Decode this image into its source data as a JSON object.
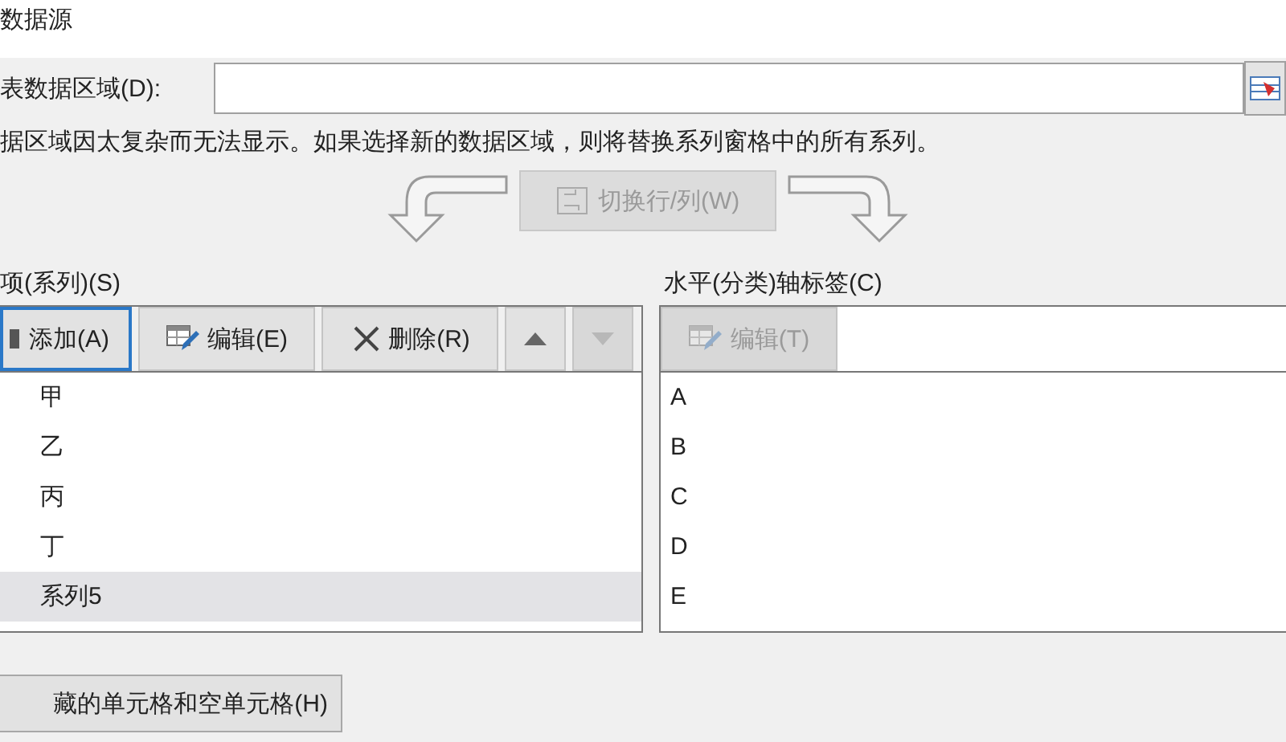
{
  "window": {
    "title": "数据源"
  },
  "range": {
    "label": "表数据区域(D):"
  },
  "message": "据区域因太复杂而无法显示。如果选择新的数据区域，则将替换系列窗格中的所有系列。",
  "switch_button": {
    "label": "切换行/列(W)",
    "disabled": true
  },
  "series_panel": {
    "label": "项(系列)(S)",
    "toolbar": [
      {
        "kind": "add",
        "label": "添加(A)",
        "focused": true,
        "disabled": false
      },
      {
        "kind": "edit",
        "label": "编辑(E)",
        "focused": false,
        "disabled": false
      },
      {
        "kind": "delete",
        "label": "删除(R)",
        "focused": false,
        "disabled": false
      },
      {
        "kind": "up",
        "focused": false,
        "disabled": false
      },
      {
        "kind": "down",
        "focused": false,
        "disabled": true
      }
    ],
    "items": [
      {
        "label": "甲",
        "selected": false
      },
      {
        "label": "乙",
        "selected": false
      },
      {
        "label": "丙",
        "selected": false
      },
      {
        "label": "丁",
        "selected": false
      },
      {
        "label": "系列5",
        "selected": true
      }
    ]
  },
  "axis_panel": {
    "label": "水平(分类)轴标签(C)",
    "toolbar": [
      {
        "kind": "edit",
        "label": "编辑(T)",
        "focused": false,
        "disabled": true
      }
    ],
    "items": [
      {
        "label": "A",
        "selected": false
      },
      {
        "label": "B",
        "selected": false
      },
      {
        "label": "C",
        "selected": false
      },
      {
        "label": "D",
        "selected": false
      },
      {
        "label": "E",
        "selected": false
      }
    ]
  },
  "hidden_cells_button": {
    "label": "藏的单元格和空单元格(H)"
  }
}
